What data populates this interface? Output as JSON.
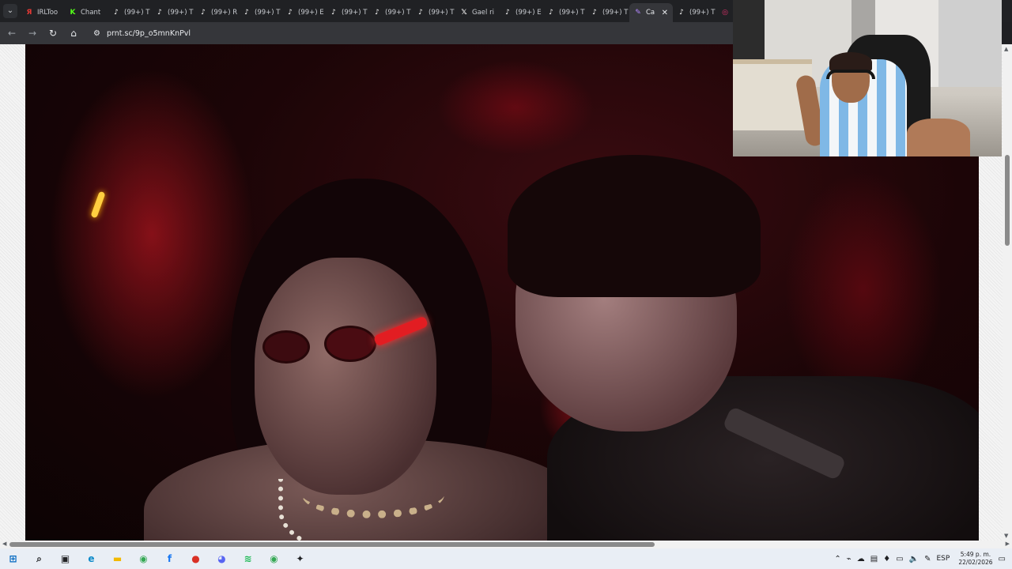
{
  "browser": {
    "tabs": [
      {
        "label": "IRLToo",
        "icon": "yandex-icon",
        "color": "#e53935",
        "glyph": "Я"
      },
      {
        "label": "Chant",
        "icon": "kick-icon",
        "color": "#53fc18",
        "glyph": "K"
      },
      {
        "label": "(99+) T",
        "icon": "tiktok-icon",
        "color": "#ffffff",
        "glyph": "♪"
      },
      {
        "label": "(99+) T",
        "icon": "tiktok-icon",
        "color": "#ffffff",
        "glyph": "♪"
      },
      {
        "label": "(99+) R",
        "icon": "tiktok-icon",
        "color": "#ffffff",
        "glyph": "♪"
      },
      {
        "label": "(99+) T",
        "icon": "tiktok-icon",
        "color": "#ffffff",
        "glyph": "♪"
      },
      {
        "label": "(99+) E",
        "icon": "tiktok-icon",
        "color": "#ffffff",
        "glyph": "♪"
      },
      {
        "label": "(99+) T",
        "icon": "tiktok-icon",
        "color": "#ffffff",
        "glyph": "♪"
      },
      {
        "label": "(99+) T",
        "icon": "tiktok-icon",
        "color": "#ffffff",
        "glyph": "♪"
      },
      {
        "label": "(99+) T",
        "icon": "tiktok-icon",
        "color": "#ffffff",
        "glyph": "♪"
      },
      {
        "label": "Gael ri",
        "icon": "x-icon",
        "color": "#ffffff",
        "glyph": "𝕏"
      },
      {
        "label": "(99+) E",
        "icon": "tiktok-icon",
        "color": "#ffffff",
        "glyph": "♪"
      },
      {
        "label": "(99+) T",
        "icon": "tiktok-icon",
        "color": "#ffffff",
        "glyph": "♪"
      },
      {
        "label": "(99+) T",
        "icon": "tiktok-icon",
        "color": "#ffffff",
        "glyph": "♪"
      },
      {
        "label": "Ca",
        "icon": "feather-icon",
        "color": "#b388ff",
        "glyph": "✎",
        "active": true
      },
      {
        "label": "(99+) T",
        "icon": "tiktok-icon",
        "color": "#ffffff",
        "glyph": "♪"
      },
      {
        "label": "",
        "icon": "instagram-icon",
        "color": "#e1306c",
        "glyph": "◎"
      }
    ],
    "url": "prnt.sc/9p_o5mnKnPvl"
  },
  "taskbar": {
    "apps": [
      {
        "name": "start-icon",
        "glyph": "⊞",
        "color": "#0067c0"
      },
      {
        "name": "search-icon",
        "glyph": "⌕",
        "color": "#202124"
      },
      {
        "name": "task-view-icon",
        "glyph": "▣",
        "color": "#202124"
      },
      {
        "name": "edge-icon",
        "glyph": "e",
        "color": "#0c8ac9"
      },
      {
        "name": "file-explorer-icon",
        "glyph": "▬",
        "color": "#f2b900"
      },
      {
        "name": "chrome-icon",
        "glyph": "◉",
        "color": "#34a853"
      },
      {
        "name": "facebook-icon",
        "glyph": "f",
        "color": "#1877f2"
      },
      {
        "name": "app-red-icon",
        "glyph": "●",
        "color": "#d93025"
      },
      {
        "name": "discord-icon",
        "glyph": "◕",
        "color": "#5865f2"
      },
      {
        "name": "spotify-icon",
        "glyph": "≋",
        "color": "#1db954"
      },
      {
        "name": "chrome-profile-icon",
        "glyph": "◉",
        "color": "#34a853"
      },
      {
        "name": "app-dark-icon",
        "glyph": "✦",
        "color": "#202124"
      }
    ],
    "language": "ESP",
    "time": "5:49 p. m.",
    "date": "22/02/2026"
  }
}
